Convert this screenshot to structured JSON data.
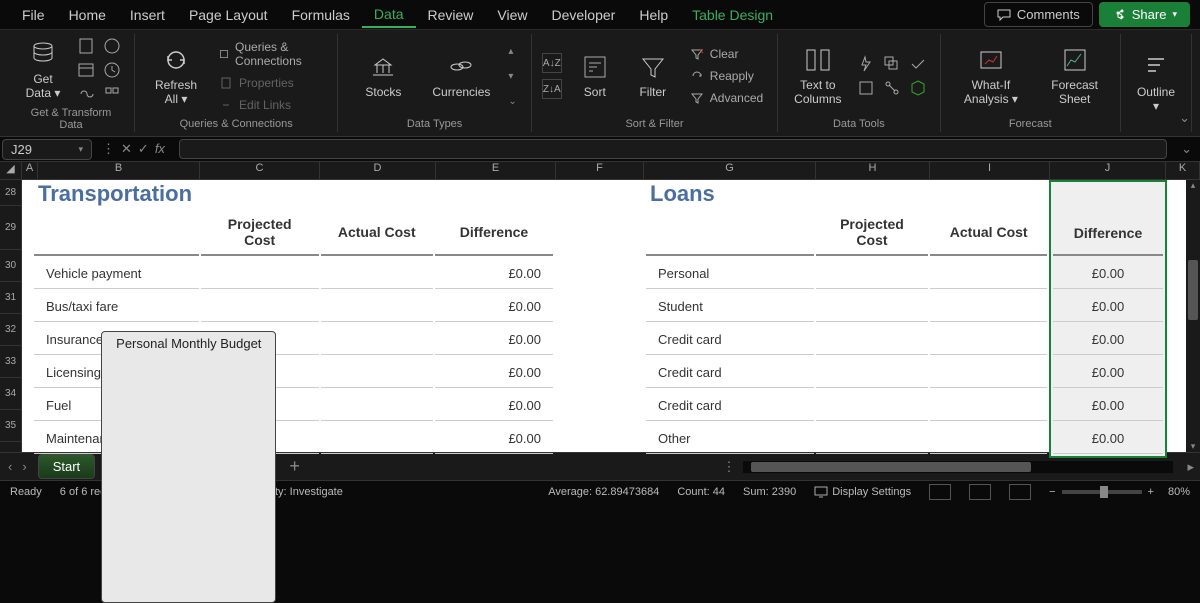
{
  "menubar": {
    "tabs": [
      "File",
      "Home",
      "Insert",
      "Page Layout",
      "Formulas",
      "Data",
      "Review",
      "View",
      "Developer",
      "Help",
      "Table Design"
    ],
    "active": "Data",
    "comments": "Comments",
    "share": "Share"
  },
  "ribbon": {
    "get_data": "Get Data",
    "refresh_all": "Refresh All",
    "queries": "Queries & Connections",
    "properties": "Properties",
    "edit_links": "Edit Links",
    "stocks": "Stocks",
    "currencies": "Currencies",
    "sort": "Sort",
    "filter": "Filter",
    "clear": "Clear",
    "reapply": "Reapply",
    "advanced": "Advanced",
    "text_to_columns": "Text to Columns",
    "whatif": "What-If Analysis",
    "forecast_sheet": "Forecast Sheet",
    "outline": "Outline",
    "groups": {
      "g1": "Get & Transform Data",
      "g2": "Queries & Connections",
      "g3": "Data Types",
      "g4": "Sort & Filter",
      "g5": "Data Tools",
      "g6": "Forecast"
    }
  },
  "formulabar": {
    "namebox": "J29"
  },
  "columns": [
    "A",
    "B",
    "C",
    "D",
    "E",
    "F",
    "G",
    "H",
    "I",
    "J",
    "K"
  ],
  "rows": [
    "28",
    "29",
    "30",
    "31",
    "32",
    "33",
    "34",
    "35"
  ],
  "sheet": {
    "left_title": "Transportation",
    "right_title": "Loans",
    "headers": {
      "projected": "Projected Cost",
      "actual": "Actual Cost",
      "difference": "Difference"
    },
    "transportation": [
      {
        "label": "Vehicle payment",
        "diff": "£0.00"
      },
      {
        "label": "Bus/taxi fare",
        "diff": "£0.00"
      },
      {
        "label": "Insurance",
        "diff": "£0.00"
      },
      {
        "label": "Licensing",
        "diff": "£0.00"
      },
      {
        "label": "Fuel",
        "diff": "£0.00"
      },
      {
        "label": "Maintenance",
        "diff": "£0.00"
      }
    ],
    "loans": [
      {
        "label": "Personal",
        "diff": "£0.00"
      },
      {
        "label": "Student",
        "diff": "£0.00"
      },
      {
        "label": "Credit card",
        "diff": "£0.00"
      },
      {
        "label": "Credit card",
        "diff": "£0.00"
      },
      {
        "label": "Credit card",
        "diff": "£0.00"
      },
      {
        "label": "Other",
        "diff": "£0.00"
      }
    ]
  },
  "sheetbar": {
    "start": "Start",
    "sheet_name": "Personal Monthly Budget"
  },
  "statusbar": {
    "ready": "Ready",
    "records": "6 of 6 records found",
    "accessibility": "Accessibility: Investigate",
    "average": "Average: 62.89473684",
    "count": "Count: 44",
    "sum": "Sum: 2390",
    "display": "Display Settings",
    "zoom": "80%"
  }
}
